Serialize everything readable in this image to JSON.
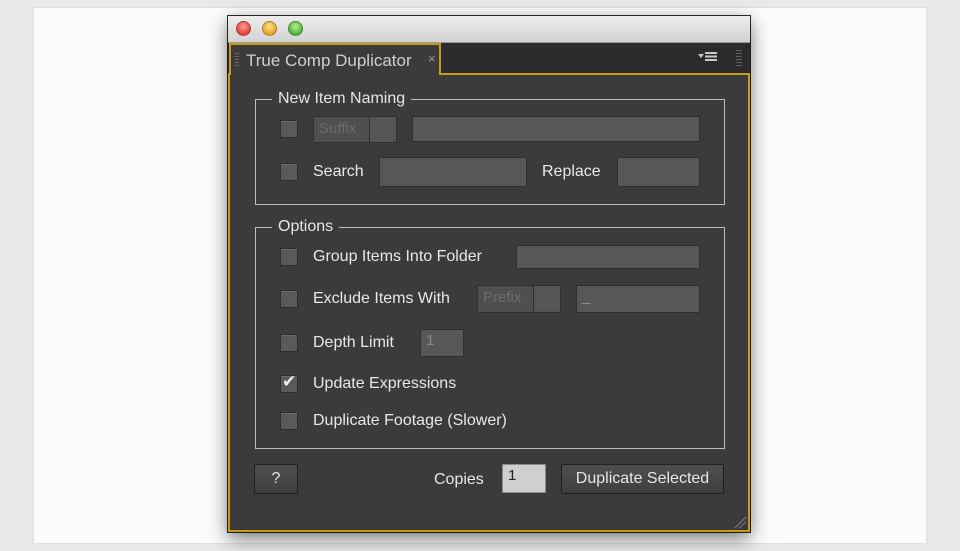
{
  "window": {
    "tab_title": "True Comp Duplicator",
    "tab_close": "×",
    "icons": [
      "close-light",
      "minimize-light",
      "zoom-light",
      "panel-menu-icon"
    ]
  },
  "naming": {
    "legend": "New Item Naming",
    "suffix_dropdown": "Suffix",
    "suffix_value": "",
    "search_label": "Search",
    "search_value": "",
    "replace_label": "Replace",
    "replace_value": ""
  },
  "options": {
    "legend": "Options",
    "group_folder_label": "Group Items Into Folder",
    "group_folder_value": "",
    "exclude_label": "Exclude Items With",
    "exclude_dropdown": "Prefix",
    "exclude_value": "_",
    "depth_label": "Depth Limit",
    "depth_value": "1",
    "update_expr_label": "Update Expressions",
    "update_expr_checked": true,
    "dup_footage_label": "Duplicate Footage (Slower)"
  },
  "footer": {
    "help_label": "?",
    "copies_label": "Copies",
    "copies_value": "1",
    "duplicate_label": "Duplicate Selected"
  },
  "colors": {
    "panel_bg": "#3b3b3b",
    "accent_border": "#c79a1a"
  }
}
